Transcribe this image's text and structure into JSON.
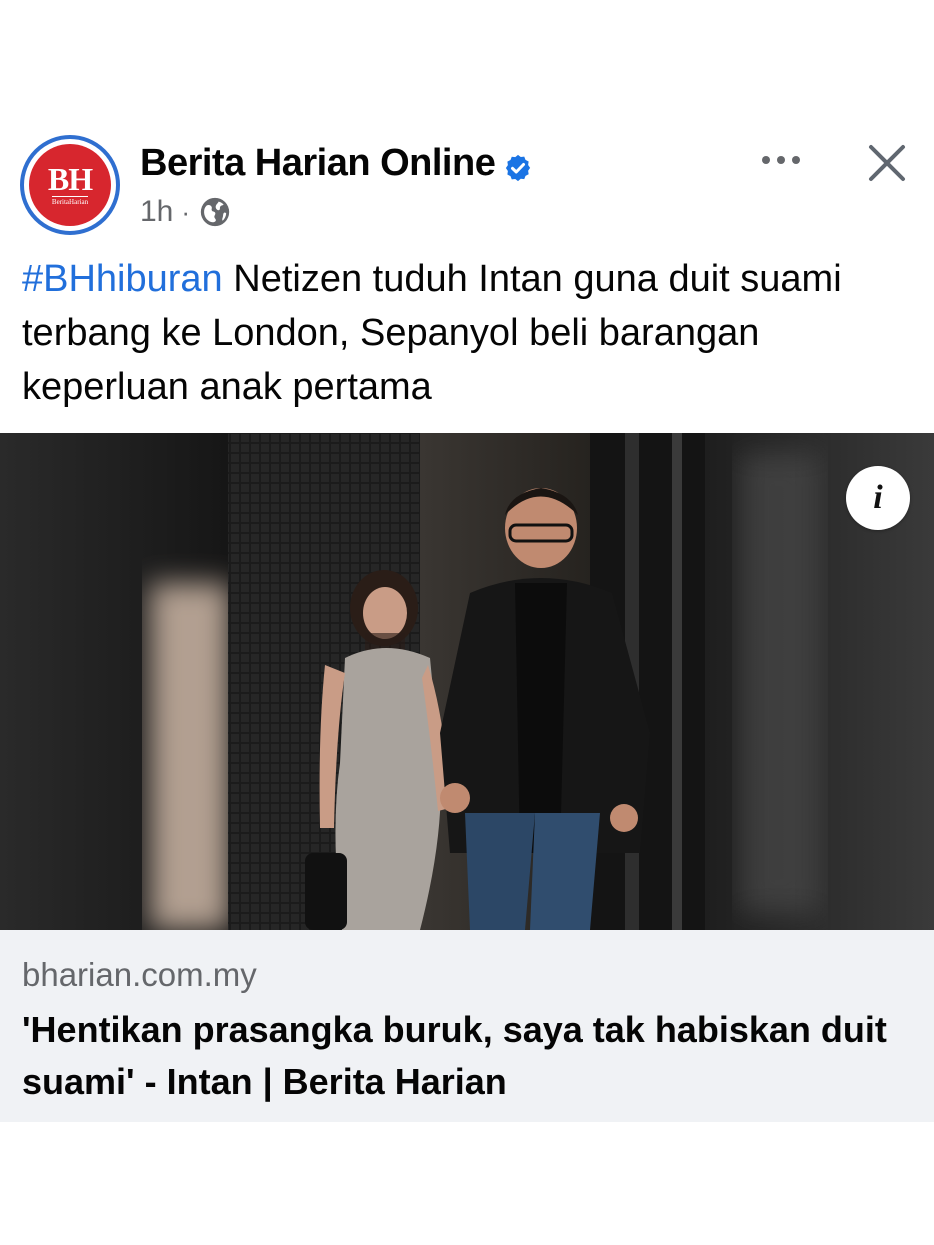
{
  "post": {
    "page_name": "Berita Harian Online",
    "avatar": {
      "mark": "BH",
      "subtitle": "BeritaHarian"
    },
    "timestamp": "1h",
    "separator": "·",
    "audience_icon": "globe-icon",
    "verified_icon": "verified-badge-icon",
    "more_icon": "more-options-icon",
    "close_icon": "close-icon",
    "caption": {
      "hashtag": "#BHhiburan",
      "text": " Netizen tuduh Intan guna duit suami terbang ke London, Sepanyol beli barangan keperluan anak pertama"
    },
    "image": {
      "info_label": "i"
    },
    "link": {
      "domain": "bharian.com.my",
      "title": "'Hentikan prasangka buruk, saya tak habiskan duit suami' - Intan | Berita Harian"
    }
  },
  "colors": {
    "brand_red": "#d7262e",
    "brand_blue": "#2f6fd0",
    "hashtag_blue": "#216fdb",
    "verified_blue": "#1b74e4",
    "secondary_text": "#65676b",
    "link_bg": "#f0f2f5"
  }
}
